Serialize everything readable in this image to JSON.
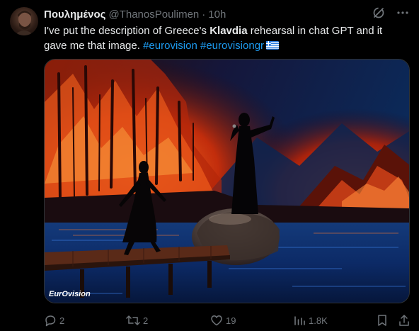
{
  "tweet": {
    "author_name": "Πουλημένος",
    "handle": "@ThanosPoulimen",
    "separator": "·",
    "time": "10h",
    "text_part1": "I've put the description of Greece's ",
    "text_bold": "Klavdia",
    "text_part2": " rehearsal in chat GPT and it gave me that image.",
    "hashtags": [
      "#eurovision",
      "#eurovisiongr"
    ],
    "flag_icon": "greece-flag"
  },
  "media": {
    "watermark": "EurOvision",
    "colors": {
      "fire": "#ff5a1a",
      "water": "#1f5fc4",
      "sky": "#0b1a3a"
    }
  },
  "actions": {
    "reply_count": "2",
    "retweet_count": "2",
    "like_count": "19",
    "views_count": "1.8K"
  },
  "icons": {
    "grok": "grok-icon",
    "more": "more-icon",
    "reply": "reply-icon",
    "retweet": "retweet-icon",
    "like": "like-icon",
    "views": "views-icon",
    "bookmark": "bookmark-icon",
    "share": "share-icon"
  },
  "colors": {
    "accent": "#1d9bf0",
    "muted": "#71767b",
    "text": "#e7e9ea",
    "background": "#000000"
  }
}
